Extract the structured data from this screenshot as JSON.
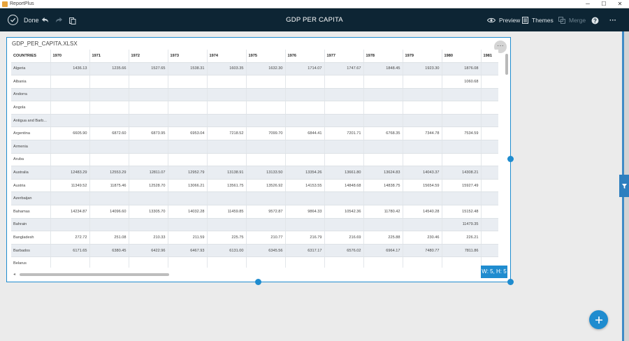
{
  "window": {
    "app_name": "ReportPlus",
    "minimize": "─",
    "maximize": "☐",
    "close": "✕"
  },
  "toolbar": {
    "done_label": "Done",
    "title": "GDP PER CAPITA",
    "preview_label": "Preview",
    "themes_label": "Themes",
    "merge_label": "Merge",
    "more_label": "···"
  },
  "widget": {
    "title": "GDP_PER_CAPITA.XLSX",
    "menu_label": "···",
    "size_badge": "W: 5, H: 5"
  },
  "table": {
    "headers": [
      "COUNTRIES",
      "1970",
      "1971",
      "1972",
      "1973",
      "1974",
      "1975",
      "1976",
      "1977",
      "1978",
      "1979",
      "1980",
      "1981"
    ],
    "rows": [
      [
        "Algeria",
        "1436.13",
        "1235.66",
        "1527.65",
        "1538.31",
        "1603.35",
        "1632.30",
        "1714.07",
        "1747.67",
        "1848.45",
        "1923.30",
        "1876.08",
        ""
      ],
      [
        "Albania",
        "",
        "",
        "",
        "",
        "",
        "",
        "",
        "",
        "",
        "",
        "1060.68",
        ""
      ],
      [
        "Andorra",
        "",
        "",
        "",
        "",
        "",
        "",
        "",
        "",
        "",
        "",
        "",
        ""
      ],
      [
        "Angola",
        "",
        "",
        "",
        "",
        "",
        "",
        "",
        "",
        "",
        "",
        "",
        ""
      ],
      [
        "Antigua and Barb...",
        "",
        "",
        "",
        "",
        "",
        "",
        "",
        "",
        "",
        "",
        "",
        ""
      ],
      [
        "Argentina",
        "6605.90",
        "6872.60",
        "6873.95",
        "6953.04",
        "7218.52",
        "7099.70",
        "6844.41",
        "7201.71",
        "6768.35",
        "7344.78",
        "7534.59",
        ""
      ],
      [
        "Armenia",
        "",
        "",
        "",
        "",
        "",
        "",
        "",
        "",
        "",
        "",
        "",
        ""
      ],
      [
        "Aruba",
        "",
        "",
        "",
        "",
        "",
        "",
        "",
        "",
        "",
        "",
        "",
        ""
      ],
      [
        "Australia",
        "12483.29",
        "12553.29",
        "12811.07",
        "12952.79",
        "13138.91",
        "13133.50",
        "13354.26",
        "13661.80",
        "13624.83",
        "14043.37",
        "14308.21",
        ""
      ],
      [
        "Austria",
        "11349.52",
        "11875.46",
        "12528.70",
        "13066.21",
        "13561.75",
        "13526.92",
        "14153.55",
        "14848.68",
        "14838.75",
        "15654.59",
        "15927.49",
        ""
      ],
      [
        "Azerbaijan",
        "",
        "",
        "",
        "",
        "",
        "",
        "",
        "",
        "",
        "",
        "",
        ""
      ],
      [
        "Bahamas",
        "14234.87",
        "14096.60",
        "13305.70",
        "14032.28",
        "11459.85",
        "9572.87",
        "9864.33",
        "10542.36",
        "11780.42",
        "14540.28",
        "15152.48",
        ""
      ],
      [
        "Bahrain",
        "",
        "",
        "",
        "",
        "",
        "",
        "",
        "",
        "",
        "",
        "11479.35",
        ""
      ],
      [
        "Bangladesh",
        "272.72",
        "251.08",
        "210.33",
        "211.59",
        "225.75",
        "210.77",
        "216.79",
        "216.69",
        "225.88",
        "230.46",
        "226.21",
        ""
      ],
      [
        "Barbados",
        "6171.65",
        "6380.45",
        "6422.96",
        "6467.93",
        "6131.00",
        "6345.56",
        "6317.17",
        "6576.02",
        "6964.17",
        "7480.77",
        "7811.86",
        ""
      ],
      [
        "Belarus",
        "",
        "",
        "",
        "",
        "",
        "",
        "",
        "",
        "",
        "",
        "",
        ""
      ]
    ]
  },
  "colors": {
    "toolbar_bg": "#0d2534",
    "accent": "#1f8ccf",
    "row_stripe": "#e9edf2"
  },
  "icons": {
    "done": "check-circle-icon",
    "undo": "undo-icon",
    "redo": "redo-icon",
    "clipboard": "clipboard-icon",
    "preview": "eye-icon",
    "themes": "themes-icon",
    "merge": "merge-icon",
    "help": "help-icon",
    "filter": "filter-icon",
    "add": "plus-icon"
  }
}
